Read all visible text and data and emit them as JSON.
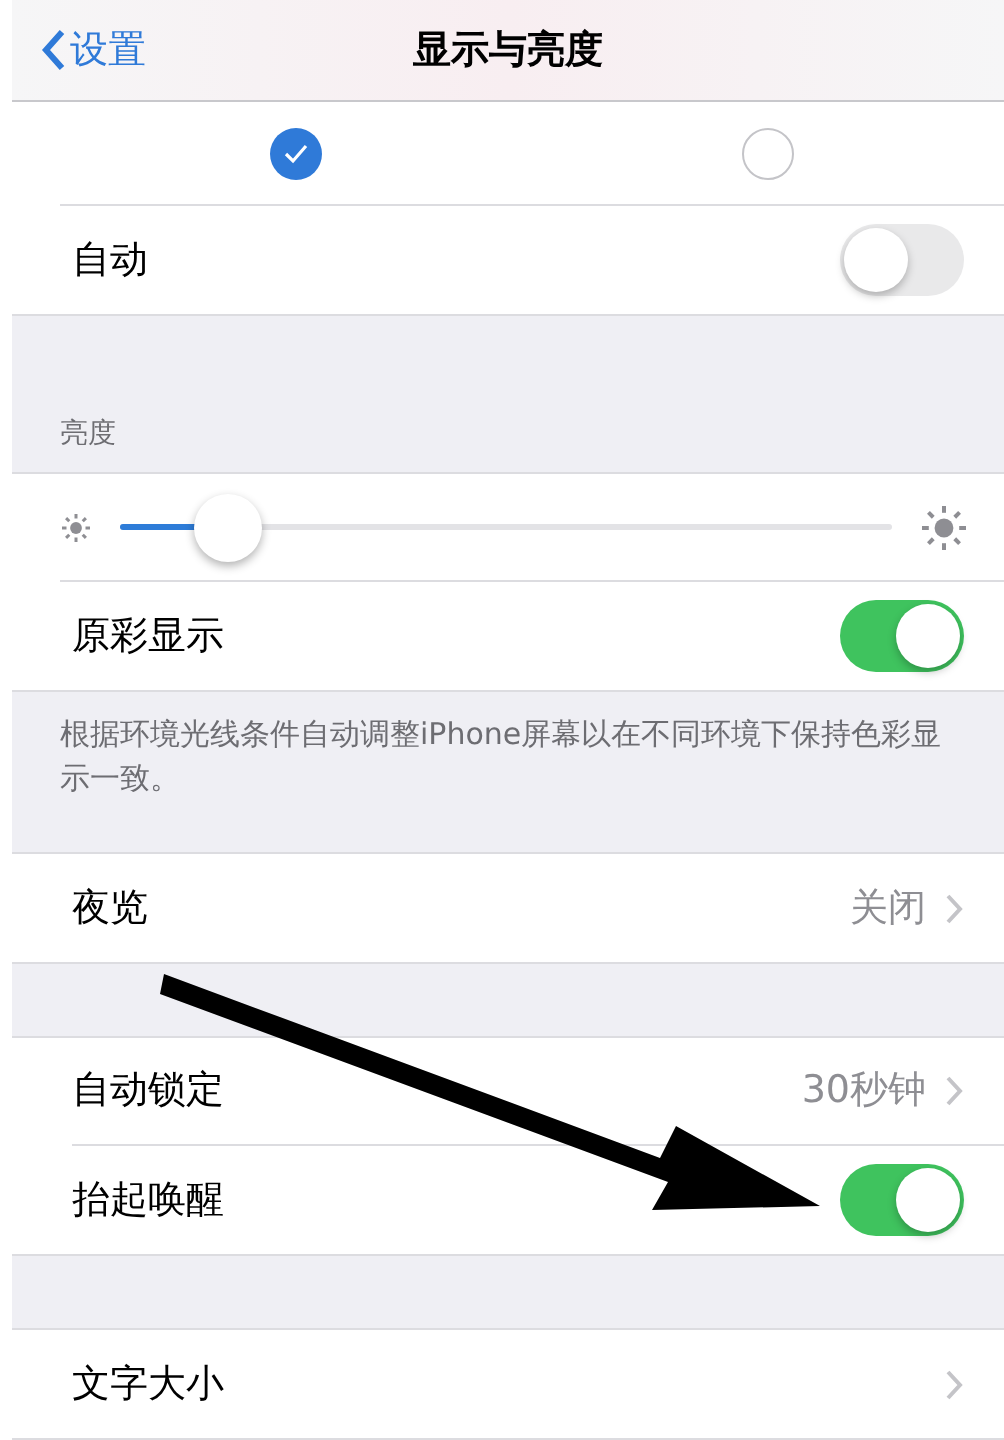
{
  "nav": {
    "back_label": "设置",
    "title": "显示与亮度"
  },
  "appearance_options": [
    {
      "selected": true
    },
    {
      "selected": false
    }
  ],
  "sections": [
    {
      "rows": [
        {
          "kind": "toggle",
          "label": "自动",
          "on": false
        }
      ]
    },
    {
      "header": "亮度",
      "rows": [
        {
          "kind": "slider",
          "level": 0.14
        },
        {
          "kind": "toggle",
          "label": "原彩显示",
          "on": true
        }
      ],
      "footer": "根据环境光线条件自动调整iPhone屏幕以在不同环境下保持色彩显示一致。"
    },
    {
      "rows": [
        {
          "kind": "disclosure",
          "label": "夜览",
          "value": "关闭"
        }
      ]
    },
    {
      "rows": [
        {
          "kind": "disclosure",
          "label": "自动锁定",
          "value": "30秒钟"
        },
        {
          "kind": "toggle",
          "label": "抬起唤醒",
          "on": true
        }
      ]
    },
    {
      "rows": [
        {
          "kind": "disclosure",
          "label": "文字大小"
        }
      ]
    }
  ]
}
